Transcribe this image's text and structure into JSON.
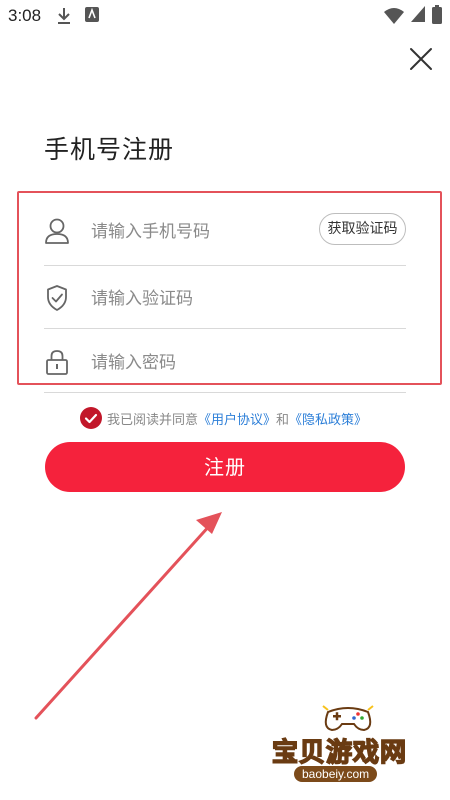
{
  "status_bar": {
    "time": "3:08",
    "icons": [
      "download-icon",
      "app-notification-icon",
      "wifi-icon",
      "battery-icon"
    ]
  },
  "header": {
    "title": "手机号注册",
    "close_icon": "close-icon"
  },
  "form": {
    "phone": {
      "placeholder": "请输入手机号码",
      "value": "",
      "icon": "user-icon"
    },
    "get_code_label": "获取验证码",
    "code": {
      "placeholder": "请输入验证码",
      "value": "",
      "icon": "shield-check-icon"
    },
    "password": {
      "placeholder": "请输入密码",
      "value": "",
      "icon": "lock-icon"
    }
  },
  "agreement": {
    "checked": true,
    "prefix": "我已阅读并同意",
    "user_agreement": "《用户协议》",
    "conjunction": "和",
    "privacy_policy": "《隐私政策》"
  },
  "register_label": "注册",
  "watermark": {
    "name": "宝贝游戏网",
    "domain": "baobeiy.com"
  },
  "colors": {
    "accent": "#f5223c",
    "link": "#2d7fd8",
    "annotation": "#e4525a",
    "checkbox": "#c2172a"
  }
}
